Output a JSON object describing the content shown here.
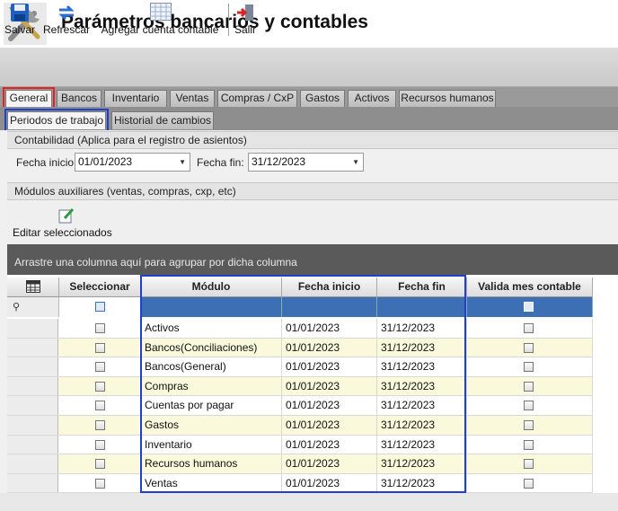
{
  "window": {
    "title": "Parámetros bancarios y contables"
  },
  "toolbar": {
    "save_label": "Salvar",
    "refresh_label": "Refrescar",
    "add_account_label": "Agregar cuenta contable",
    "exit_label": "Salir"
  },
  "main_tabs": [
    "General",
    "Bancos",
    "Inventario",
    "Ventas",
    "Compras / CxP",
    "Gastos",
    "Activos",
    "Recursos humanos"
  ],
  "sub_tabs": [
    "Periodos de trabajo",
    "Historial de cambios"
  ],
  "accounting_section": {
    "title": "Contabilidad (Aplica para el registro de asientos)",
    "start_label": "Fecha inicio:",
    "start_value": "01/01/2023",
    "end_label": "Fecha fin:",
    "end_value": "31/12/2023"
  },
  "aux_section": {
    "title": "Módulos auxiliares (ventas, compras, cxp, etc)"
  },
  "grid_toolbar": {
    "edit_label": "Editar seleccionados"
  },
  "group_by_hint": "Arrastre una columna aquí para agrupar por dicha columna",
  "grid": {
    "columns": [
      "Seleccionar",
      "Módulo",
      "Fecha inicio",
      "Fecha fin",
      "Valida mes contable"
    ],
    "rows": [
      {
        "module": "Activos",
        "start": "01/01/2023",
        "end": "31/12/2023"
      },
      {
        "module": "Bancos(Conciliaciones)",
        "start": "01/01/2023",
        "end": "31/12/2023"
      },
      {
        "module": "Bancos(General)",
        "start": "01/01/2023",
        "end": "31/12/2023"
      },
      {
        "module": "Compras",
        "start": "01/01/2023",
        "end": "31/12/2023"
      },
      {
        "module": "Cuentas por pagar",
        "start": "01/01/2023",
        "end": "31/12/2023"
      },
      {
        "module": "Gastos",
        "start": "01/01/2023",
        "end": "31/12/2023"
      },
      {
        "module": "Inventario",
        "start": "01/01/2023",
        "end": "31/12/2023"
      },
      {
        "module": "Recursos humanos",
        "start": "01/01/2023",
        "end": "31/12/2023"
      },
      {
        "module": "Ventas",
        "start": "01/01/2023",
        "end": "31/12/2023"
      }
    ]
  },
  "colors": {
    "selected_tab_outline": "#e02424",
    "highlight_outline": "#1f3fd1",
    "filter_row": "#3d6fb4",
    "alt_row": "#fbf9dc"
  }
}
